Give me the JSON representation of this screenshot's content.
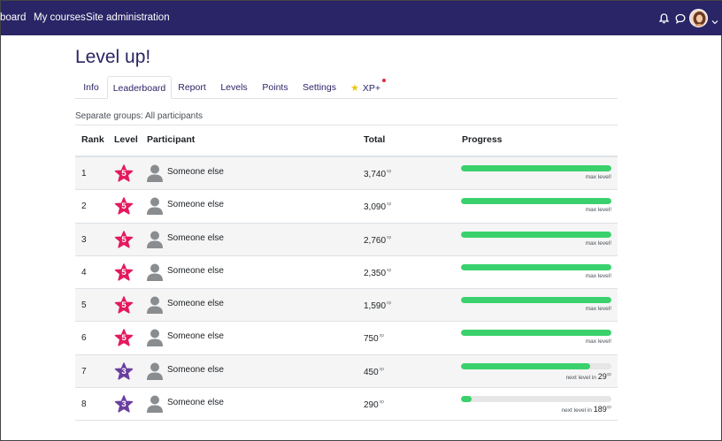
{
  "navbar": {
    "links": [
      "board",
      "My courses",
      "Site administration"
    ],
    "bell_icon": "bell-icon",
    "chat_icon": "chat-icon",
    "color": "#2a2566"
  },
  "page": {
    "title": "Level up!"
  },
  "tabs": [
    "Info",
    "Leaderboard",
    "Report",
    "Levels",
    "Points",
    "Settings",
    "XP+"
  ],
  "active_tab": "Leaderboard",
  "groups_label": "Separate groups: All participants",
  "table": {
    "headers": [
      "Rank",
      "Level",
      "Participant",
      "Total",
      "Progress"
    ],
    "xp_unit": "xp",
    "rows": [
      {
        "rank": "1",
        "level": "5",
        "name": "Someone else",
        "total": "3,740",
        "progress": 1.0,
        "label": "max level!"
      },
      {
        "rank": "2",
        "level": "5",
        "name": "Someone else",
        "total": "3,090",
        "progress": 1.0,
        "label": "max level!"
      },
      {
        "rank": "3",
        "level": "5",
        "name": "Someone else",
        "total": "2,760",
        "progress": 1.0,
        "label": "max level!"
      },
      {
        "rank": "4",
        "level": "5",
        "name": "Someone else",
        "total": "2,350",
        "progress": 1.0,
        "label": "max level!"
      },
      {
        "rank": "5",
        "level": "5",
        "name": "Someone else",
        "total": "1,590",
        "progress": 1.0,
        "label": "max level!"
      },
      {
        "rank": "6",
        "level": "5",
        "name": "Someone else",
        "total": "750",
        "progress": 1.0,
        "label": "max level!"
      },
      {
        "rank": "7",
        "level": "3",
        "name": "Someone else",
        "total": "450",
        "progress": 0.86,
        "label": "next level in",
        "label_value": "29"
      },
      {
        "rank": "8",
        "level": "3",
        "name": "Someone else",
        "total": "290",
        "progress": 0.07,
        "label": "next level in",
        "label_value": "189"
      }
    ]
  },
  "colors": {
    "level5": "#e5195f",
    "level3": "#6b3fa0",
    "progress": "#3ad16c",
    "progress_track": "#e6e6e6"
  }
}
